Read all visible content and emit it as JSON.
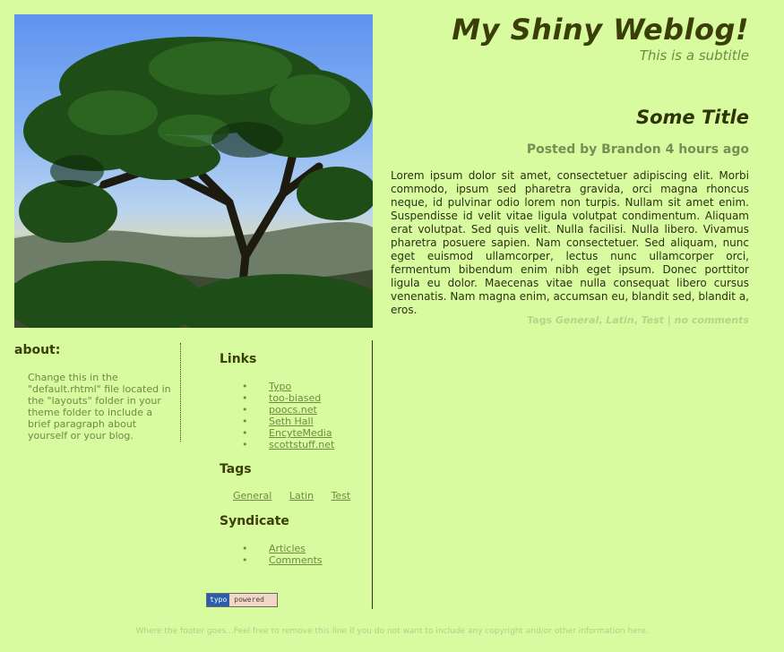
{
  "header": {
    "title": "My Shiny Weblog!",
    "subtitle": "This is a subtitle"
  },
  "post": {
    "title": "Some Title",
    "meta": "Posted by Brandon 4 hours ago",
    "body": "Lorem ipsum dolor sit amet, consectetuer adipiscing elit. Morbi commodo, ipsum sed pharetra gravida, orci magna rhoncus neque, id pulvinar odio lorem non turpis. Nullam sit amet enim. Suspendisse id velit vitae ligula volutpat condimentum. Aliquam erat volutpat. Sed quis velit. Nulla facilisi. Nulla libero. Vivamus pharetra posuere sapien. Nam consectetuer. Sed aliquam, nunc eget euismod ullamcorper, lectus nunc ullamcorper orci, fermentum bibendum enim nibh eget ipsum. Donec porttitor ligula eu dolor. Maecenas vitae nulla consequat libero cursus venenatis. Nam magna enim, accumsan eu, blandit sed, blandit a, eros.",
    "tags_prefix": "Tags",
    "tags": [
      "General",
      "Latin",
      "Test"
    ],
    "comments_link": "no comments"
  },
  "about": {
    "heading": "about:",
    "text": "Change this in the \"default.rhtml\" file located in the \"layouts\" folder in your theme folder to include a brief paragraph about yourself or your blog."
  },
  "sidebar": {
    "links_heading": "Links",
    "links": [
      "Typo",
      "too-biased",
      "poocs.net",
      "Seth Hall",
      "EncyteMedia",
      "scottstuff.net"
    ],
    "tags_heading": "Tags",
    "tags": [
      "General",
      "Latin",
      "Test"
    ],
    "syndicate_heading": "Syndicate",
    "syndicate": [
      "Articles",
      "Comments"
    ]
  },
  "badge": {
    "left": "typo",
    "right": "powered"
  },
  "footer": {
    "text": "Where the footer goes...Feel free to remove this line if you do not want to include any copyright and/or other information here."
  },
  "colors": {
    "background": "#d9fba0",
    "title": "#3a3f08",
    "accent": "#6f8a43",
    "muted": "#b6d489"
  }
}
